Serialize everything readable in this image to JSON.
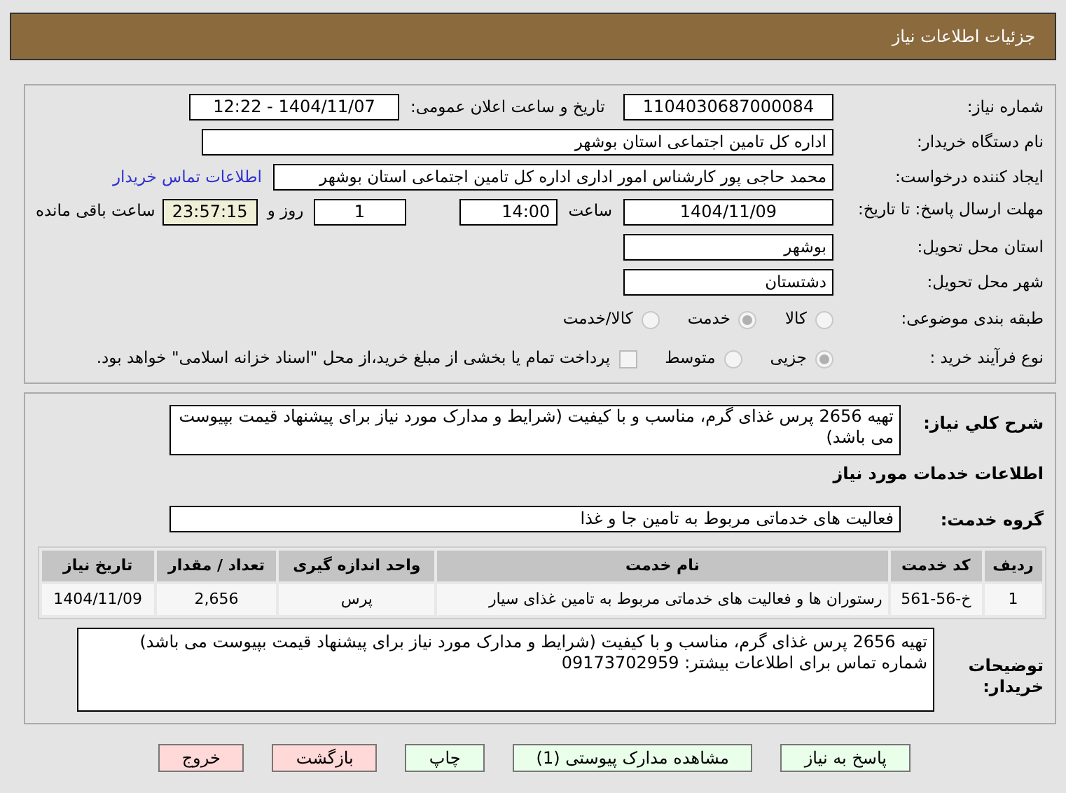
{
  "header": {
    "title": "جزئیات اطلاعات نیاز"
  },
  "need_number": {
    "label": "شماره نیاز:",
    "value": "1104030687000084"
  },
  "announce": {
    "label": "تاریخ و ساعت اعلان عمومی:",
    "value": "1404/11/07 - 12:22"
  },
  "buyer": {
    "label": "نام دستگاه خریدار:",
    "value": "اداره کل تامین اجتماعی استان بوشهر"
  },
  "creator": {
    "label": "ایجاد کننده درخواست:",
    "value": "محمد حاجی پور کارشناس امور اداری اداره کل تامین اجتماعی استان بوشهر",
    "link": "اطلاعات تماس خریدار"
  },
  "deadline": {
    "label": "مهلت ارسال پاسخ: تا تاریخ:",
    "date": "1404/11/09",
    "time_label": "ساعت",
    "time": "14:00",
    "days": "1",
    "days_label": "روز و",
    "remaining": "23:57:15",
    "remaining_label": "ساعت باقی مانده"
  },
  "province": {
    "label": "استان محل تحویل:",
    "value": "بوشهر"
  },
  "city": {
    "label": "شهر محل تحویل:",
    "value": "دشتستان"
  },
  "category": {
    "label": "طبقه بندی موضوعی:",
    "options": [
      {
        "label": "کالا",
        "selected": false
      },
      {
        "label": "خدمت",
        "selected": true
      },
      {
        "label": "کالا/خدمت",
        "selected": false
      }
    ]
  },
  "purchase_type": {
    "label": "نوع فرآیند خرید :",
    "options": [
      {
        "label": "جزیی",
        "selected": true
      },
      {
        "label": "متوسط",
        "selected": false
      }
    ],
    "treasury": {
      "label": "پرداخت تمام یا بخشی از مبلغ خرید،از محل \"اسناد خزانه اسلامی\" خواهد بود.",
      "checked": false
    }
  },
  "description": {
    "label": "شرح کلي نیاز:",
    "value": "تهیه 2656 پرس غذای گرم، مناسب و با کیفیت (شرایط و مدارک مورد نیاز برای پیشنهاد قیمت بپیوست می باشد)"
  },
  "services_title": "اطلاعات خدمات مورد نیاز",
  "service_group": {
    "label": "گروه خدمت:",
    "value": "فعالیت های خدماتی مربوط به تامین جا و غذا"
  },
  "table": {
    "columns": [
      "ردیف",
      "کد خدمت",
      "نام خدمت",
      "واحد اندازه گیری",
      "تعداد / مقدار",
      "تاریخ نیاز"
    ],
    "rows": [
      [
        "1",
        "خ-56-561",
        "رستوران ها و فعالیت های خدماتی مربوط به تامین غذای سیار",
        "پرس",
        "2,656",
        "1404/11/09"
      ]
    ]
  },
  "buyer_notes": {
    "label": "توضیحات خریدار:",
    "lines": [
      "تهیه 2656 پرس غذای گرم، مناسب و با کیفیت (شرایط و مدارک مورد نیاز برای پیشنهاد قیمت بپیوست می باشد)",
      "شماره تماس برای اطلاعات بیشتر: 09173702959"
    ]
  },
  "buttons": [
    {
      "label": "پاسخ به نیاز",
      "kind": "primary"
    },
    {
      "label": "مشاهده مدارک پیوستی (1)",
      "kind": "primary"
    },
    {
      "label": "چاپ",
      "kind": "primary"
    },
    {
      "label": "بازگشت",
      "kind": "danger"
    },
    {
      "label": "خروج",
      "kind": "danger"
    }
  ]
}
